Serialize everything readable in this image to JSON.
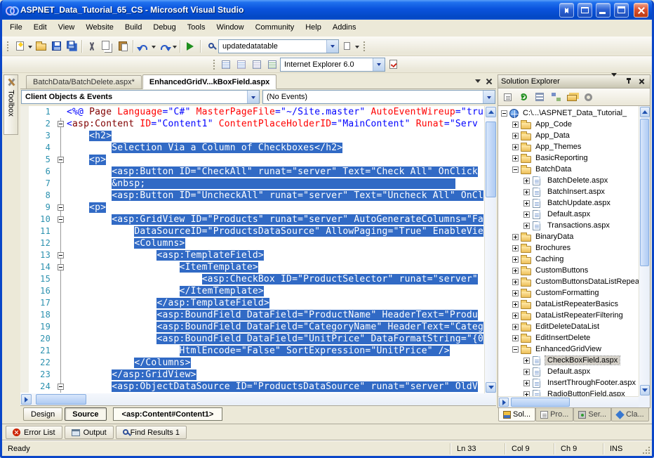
{
  "window": {
    "title": "ASPNET_Data_Tutorial_65_CS - Microsoft Visual Studio"
  },
  "menu": {
    "items": [
      "File",
      "Edit",
      "View",
      "Website",
      "Build",
      "Debug",
      "Tools",
      "Window",
      "Community",
      "Help",
      "Addins"
    ]
  },
  "toolbar": {
    "find_value": "updatedatatable",
    "browser_target": "Internet Explorer 6.0"
  },
  "toolbox": {
    "label": "Toolbox"
  },
  "editor": {
    "tabs": [
      {
        "label": "BatchData/BatchDelete.aspx*",
        "active": false
      },
      {
        "label": "EnhancedGridV...kBoxField.aspx",
        "active": true
      }
    ],
    "object_dropdown": "Client Objects & Events",
    "event_dropdown": "(No Events)",
    "viewbar": {
      "design": "Design",
      "source": "Source",
      "tag": "<asp:Content#Content1>"
    },
    "lines": [
      {
        "num": "1",
        "fold": "",
        "segments": [
          [
            "b",
            "<%@ "
          ],
          [
            "m",
            "Page "
          ],
          [
            "r",
            "Language"
          ],
          [
            "b",
            "=\"C#\" "
          ],
          [
            "r",
            "MasterPageFile"
          ],
          [
            "b",
            "=\"~/Site.master\" "
          ],
          [
            "r",
            "AutoEventWireup"
          ],
          [
            "b",
            "=\"tru"
          ]
        ]
      },
      {
        "num": "2",
        "fold": "-",
        "segments": [
          [
            "b",
            "<"
          ],
          [
            "m",
            "asp:Content "
          ],
          [
            "r",
            "ID"
          ],
          [
            "b",
            "=\"Content1\" "
          ],
          [
            "r",
            "ContentPlaceHolderID"
          ],
          [
            "b",
            "=\"MainContent\" "
          ],
          [
            "r",
            "Runat"
          ],
          [
            "b",
            "=\"Serv"
          ]
        ]
      },
      {
        "num": "3",
        "fold": "|",
        "indent": "    ",
        "sel": "<h2>"
      },
      {
        "num": "4",
        "fold": "|",
        "indent": "        ",
        "sel": "Selection Via a Column of Checkboxes</h2>"
      },
      {
        "num": "5",
        "fold": "-",
        "indent": "    ",
        "sel": "<p>"
      },
      {
        "num": "6",
        "fold": "|",
        "indent": "        ",
        "sel": "<asp:Button ID=\"CheckAll\" runat=\"server\" Text=\"Check All\" OnClick"
      },
      {
        "num": "7",
        "fold": "|",
        "indent": "        ",
        "sel": "&nbsp;                                                       "
      },
      {
        "num": "8",
        "fold": "|",
        "indent": "        ",
        "sel": "<asp:Button ID=\"UncheckAll\" runat=\"server\" Text=\"Uncheck All\" OnCl"
      },
      {
        "num": "9",
        "fold": "-",
        "indent": "    ",
        "sel": "<p>"
      },
      {
        "num": "10",
        "fold": "-",
        "indent": "        ",
        "sel": "<asp:GridView ID=\"Products\" runat=\"server\" AutoGenerateColumns=\"Fa"
      },
      {
        "num": "11",
        "fold": "|",
        "indent": "            ",
        "sel": "DataSourceID=\"ProductsDataSource\" AllowPaging=\"True\" EnableVie"
      },
      {
        "num": "12",
        "fold": "|",
        "indent": "            ",
        "sel": "<Columns>"
      },
      {
        "num": "13",
        "fold": "-",
        "indent": "                ",
        "sel": "<asp:TemplateField>"
      },
      {
        "num": "14",
        "fold": "-",
        "indent": "                    ",
        "sel": "<ItemTemplate>"
      },
      {
        "num": "15",
        "fold": "|",
        "indent": "                        ",
        "sel": "<asp:CheckBox ID=\"ProductSelector\" runat=\"server\""
      },
      {
        "num": "16",
        "fold": "|",
        "indent": "                    ",
        "sel": "</ItemTemplate>"
      },
      {
        "num": "17",
        "fold": "|",
        "indent": "                ",
        "sel": "</asp:TemplateField>"
      },
      {
        "num": "18",
        "fold": "|",
        "indent": "                ",
        "sel": "<asp:BoundField DataField=\"ProductName\" HeaderText=\"Produ"
      },
      {
        "num": "19",
        "fold": "|",
        "indent": "                ",
        "sel": "<asp:BoundField DataField=\"CategoryName\" HeaderText=\"Categ"
      },
      {
        "num": "20",
        "fold": "|",
        "indent": "                ",
        "sel": "<asp:BoundField DataField=\"UnitPrice\" DataFormatString=\"{0"
      },
      {
        "num": "21",
        "fold": "|",
        "indent": "                    ",
        "sel": "HtmlEncode=\"False\" SortExpression=\"UnitPrice\" />"
      },
      {
        "num": "22",
        "fold": "|",
        "indent": "            ",
        "sel": "</Columns>"
      },
      {
        "num": "23",
        "fold": "|",
        "indent": "        ",
        "sel": "</asp:GridView>"
      },
      {
        "num": "24",
        "fold": "-",
        "indent": "        ",
        "sel": "<asp:ObjectDataSource ID=\"ProductsDataSource\" runat=\"server\" OldV"
      }
    ]
  },
  "solution_explorer": {
    "title": "Solution Explorer",
    "tree": [
      {
        "label": "C:\\...\\ASPNET_Data_Tutorial_",
        "level": 0,
        "exp": "-",
        "icon": "site"
      },
      {
        "label": "App_Code",
        "level": 1,
        "exp": "+",
        "icon": "folder"
      },
      {
        "label": "App_Data",
        "level": 1,
        "exp": "+",
        "icon": "folder"
      },
      {
        "label": "App_Themes",
        "level": 1,
        "exp": "+",
        "icon": "folder"
      },
      {
        "label": "BasicReporting",
        "level": 1,
        "exp": "+",
        "icon": "folder"
      },
      {
        "label": "BatchData",
        "level": 1,
        "exp": "-",
        "icon": "folder"
      },
      {
        "label": "BatchDelete.aspx",
        "level": 2,
        "exp": "+",
        "icon": "page"
      },
      {
        "label": "BatchInsert.aspx",
        "level": 2,
        "exp": "+",
        "icon": "page"
      },
      {
        "label": "BatchUpdate.aspx",
        "level": 2,
        "exp": "+",
        "icon": "page"
      },
      {
        "label": "Default.aspx",
        "level": 2,
        "exp": "+",
        "icon": "page"
      },
      {
        "label": "Transactions.aspx",
        "level": 2,
        "exp": "+",
        "icon": "page"
      },
      {
        "label": "BinaryData",
        "level": 1,
        "exp": "+",
        "icon": "folder"
      },
      {
        "label": "Brochures",
        "level": 1,
        "exp": "+",
        "icon": "folder"
      },
      {
        "label": "Caching",
        "level": 1,
        "exp": "+",
        "icon": "folder"
      },
      {
        "label": "CustomButtons",
        "level": 1,
        "exp": "+",
        "icon": "folder"
      },
      {
        "label": "CustomButtonsDataListRepeat",
        "level": 1,
        "exp": "+",
        "icon": "folder"
      },
      {
        "label": "CustomFormatting",
        "level": 1,
        "exp": "+",
        "icon": "folder"
      },
      {
        "label": "DataListRepeaterBasics",
        "level": 1,
        "exp": "+",
        "icon": "folder"
      },
      {
        "label": "DataListRepeaterFiltering",
        "level": 1,
        "exp": "+",
        "icon": "folder"
      },
      {
        "label": "EditDeleteDataList",
        "level": 1,
        "exp": "+",
        "icon": "folder"
      },
      {
        "label": "EditInsertDelete",
        "level": 1,
        "exp": "+",
        "icon": "folder"
      },
      {
        "label": "EnhancedGridView",
        "level": 1,
        "exp": "-",
        "icon": "folder"
      },
      {
        "label": "CheckBoxField.aspx",
        "level": 2,
        "exp": "+",
        "icon": "page",
        "selected": true
      },
      {
        "label": "Default.aspx",
        "level": 2,
        "exp": "+",
        "icon": "page"
      },
      {
        "label": "InsertThroughFooter.aspx",
        "level": 2,
        "exp": "+",
        "icon": "page"
      },
      {
        "label": "RadioButtonField.aspx",
        "level": 2,
        "exp": "+",
        "icon": "page"
      }
    ],
    "tabs": [
      {
        "label": "Sol...",
        "active": true
      },
      {
        "label": "Pro...",
        "active": false
      },
      {
        "label": "Ser...",
        "active": false
      },
      {
        "label": "Cla...",
        "active": false
      }
    ]
  },
  "bottom_panel": {
    "tabs": [
      {
        "label": "Error List",
        "icon": "error-list"
      },
      {
        "label": "Output",
        "icon": "output"
      },
      {
        "label": "Find Results 1",
        "icon": "find-results"
      }
    ]
  },
  "status": {
    "message": "Ready",
    "line": "Ln 33",
    "column": "Col 9",
    "character": "Ch 9",
    "mode": "INS"
  }
}
